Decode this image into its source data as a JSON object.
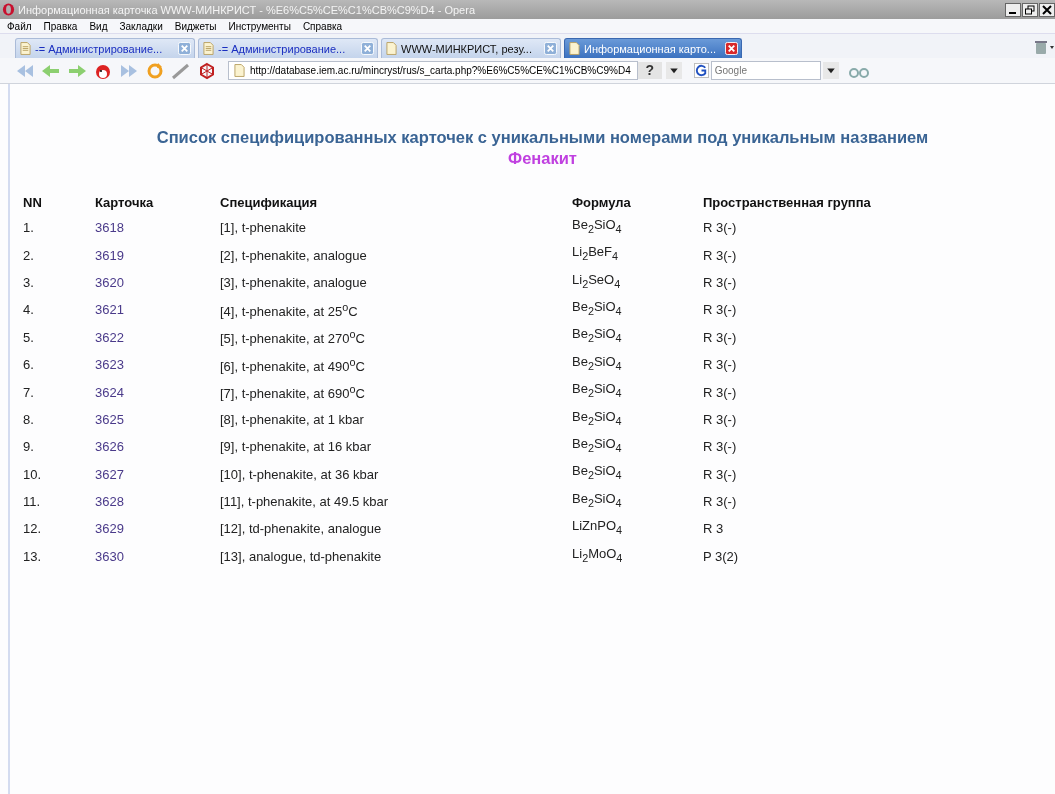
{
  "window": {
    "title": "Информационная карточка WWW-МИНКРИСТ - %E6%C5%CE%C1%CB%C9%D4 - Opera"
  },
  "menu": [
    "Файл",
    "Правка",
    "Вид",
    "Закладки",
    "Виджеты",
    "Инструменты",
    "Справка"
  ],
  "tabs": [
    {
      "label": "-= Администрирование...",
      "selected": false
    },
    {
      "label": "-= Администрирование...",
      "selected": false
    },
    {
      "label": "WWW-МИНКРИСТ, резу...",
      "selected": false
    },
    {
      "label": "Информационная карто...",
      "selected": true
    }
  ],
  "address": {
    "value": "http://database.iem.ac.ru/mincryst/rus/s_carta.php?%E6%C5%CE%C1%CB%C9%D4",
    "help": "?"
  },
  "search": {
    "placeholder": "Google"
  },
  "page": {
    "title": "Список специфицированных карточек с уникальными номерами под уникальным названием",
    "subtitle": "Фенакит",
    "columns": [
      "NN",
      "Карточка",
      "Спецификация",
      "Формула",
      "Пространственная группа"
    ],
    "rows": [
      {
        "nn": "1.",
        "card": "3618",
        "spec": "[1], t-phenakite",
        "formula": "Be$_{2}$SiO$_{4}$",
        "group": "R 3(-)"
      },
      {
        "nn": "2.",
        "card": "3619",
        "spec": "[2], t-phenakite, analogue",
        "formula": "Li$_{2}$BeF$_{4}$",
        "group": "R 3(-)"
      },
      {
        "nn": "3.",
        "card": "3620",
        "spec": "[3], t-phenakite, analogue",
        "formula": "Li$_{2}$SeO$_{4}$",
        "group": "R 3(-)"
      },
      {
        "nn": "4.",
        "card": "3621",
        "spec": "[4], t-phenakite, at 25$^{o}$C",
        "formula": "Be$_{2}$SiO$_{4}$",
        "group": "R 3(-)"
      },
      {
        "nn": "5.",
        "card": "3622",
        "spec": "[5], t-phenakite, at 270$^{o}$C",
        "formula": "Be$_{2}$SiO$_{4}$",
        "group": "R 3(-)"
      },
      {
        "nn": "6.",
        "card": "3623",
        "spec": "[6], t-phenakite, at 490$^{o}$C",
        "formula": "Be$_{2}$SiO$_{4}$",
        "group": "R 3(-)"
      },
      {
        "nn": "7.",
        "card": "3624",
        "spec": "[7], t-phenakite, at 690$^{o}$C",
        "formula": "Be$_{2}$SiO$_{4}$",
        "group": "R 3(-)"
      },
      {
        "nn": "8.",
        "card": "3625",
        "spec": "[8], t-phenakite, at 1 kbar",
        "formula": "Be$_{2}$SiO$_{4}$",
        "group": "R 3(-)"
      },
      {
        "nn": "9.",
        "card": "3626",
        "spec": "[9], t-phenakite, at 16 kbar",
        "formula": "Be$_{2}$SiO$_{4}$",
        "group": "R 3(-)"
      },
      {
        "nn": "10.",
        "card": "3627",
        "spec": "[10], t-phenakite, at 36 kbar",
        "formula": "Be$_{2}$SiO$_{4}$",
        "group": "R 3(-)"
      },
      {
        "nn": "11.",
        "card": "3628",
        "spec": "[11], t-phenakite, at 49.5 kbar",
        "formula": "Be$_{2}$SiO$_{4}$",
        "group": "R 3(-)"
      },
      {
        "nn": "12.",
        "card": "3629",
        "spec": "[12], td-phenakite, analogue",
        "formula": "LiZnPO$_{4}$",
        "group": "R 3"
      },
      {
        "nn": "13.",
        "card": "3630",
        "spec": "[13], analogue, td-phenakite",
        "formula": "Li$_{2}$MoO$_{4}$",
        "group": "P 3(2)"
      }
    ]
  }
}
